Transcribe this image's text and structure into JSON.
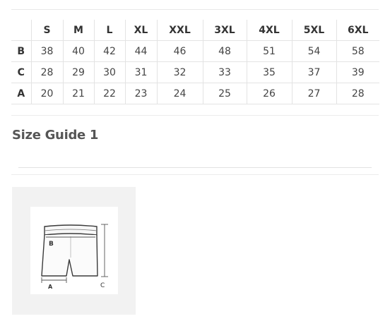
{
  "size_table": {
    "headers": [
      "",
      "S",
      "M",
      "L",
      "XL",
      "XXL",
      "3XL",
      "4XL",
      "5XL",
      "6XL"
    ],
    "rows": [
      {
        "label": "B",
        "values": [
          "38",
          "40",
          "42",
          "44",
          "46",
          "48",
          "51",
          "54",
          "58"
        ]
      },
      {
        "label": "C",
        "values": [
          "28",
          "29",
          "30",
          "31",
          "32",
          "33",
          "35",
          "37",
          "39"
        ]
      },
      {
        "label": "A",
        "values": [
          "20",
          "21",
          "22",
          "23",
          "24",
          "25",
          "26",
          "27",
          "28"
        ]
      }
    ]
  },
  "guide": {
    "title": "Size Guide 1"
  },
  "diagram": {
    "labels": {
      "a": "A",
      "b": "B",
      "c": "C"
    }
  }
}
